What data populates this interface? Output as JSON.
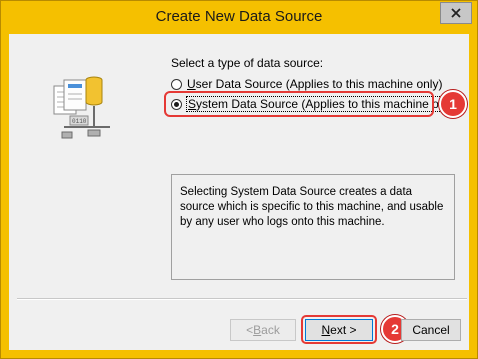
{
  "window": {
    "title": "Create New Data Source"
  },
  "prompt": "Select a type of data source:",
  "options": [
    {
      "label_u": "U",
      "label_rest": "ser Data Source (Applies to this machine only)",
      "checked": false
    },
    {
      "label_u": "S",
      "label_rest": "ystem Data Source (Applies to this machine only)",
      "checked": true
    }
  ],
  "description": "Selecting System Data Source creates a data source which is specific to this machine, and usable by any user who logs onto this machine.",
  "buttons": {
    "back": {
      "pre": "< ",
      "u": "B",
      "rest": "ack"
    },
    "next": {
      "pre": "",
      "u": "N",
      "rest": "ext >"
    },
    "cancel": "Cancel"
  },
  "callouts": [
    "1",
    "2"
  ],
  "colors": {
    "frame": "#f5c000",
    "callout": "#e53935",
    "client": "#f0f0f0"
  },
  "icons": {
    "close": "close-icon",
    "datasource": "data-source-icon"
  }
}
